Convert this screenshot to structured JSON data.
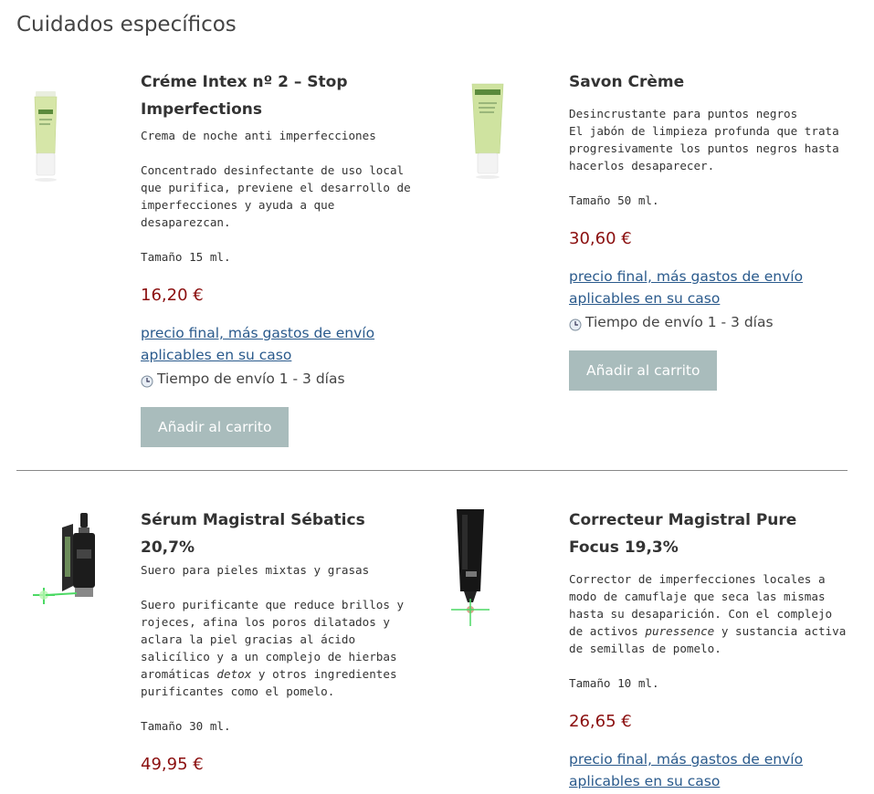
{
  "section_title": "Cuidados específicos",
  "products": [
    {
      "name": "Créme Intex nº 2 – Stop Imperfections",
      "subtitle": "Crema de noche anti imperfecciones",
      "description": "Concentrado desinfectante de uso local que purifica, previene el desarrollo de imperfecciones y ayuda a que desaparezcan.",
      "size": "Tamaño 15 ml.",
      "price": "16,20 €",
      "price_note": "precio final, más gastos de envío aplicables en su caso",
      "shipping": "Tiempo de envío 1 - 3 días",
      "button": "Añadir al carrito"
    },
    {
      "name": "Savon Crème",
      "subtitle": "Desincrustante para puntos negros",
      "description": "El jabón de limpieza profunda que trata progresivamente los puntos negros hasta hacerlos desaparecer.",
      "size": "Tamaño 50 ml.",
      "price": "30,60 €",
      "price_note": "precio final, más gastos de envío aplicables en su caso",
      "shipping": "Tiempo de envío 1 - 3 días",
      "button": "Añadir al carrito"
    },
    {
      "name": "Sérum Magistral Sébatics 20,7%",
      "subtitle": "Suero para pieles mixtas y grasas",
      "description_before": "Suero purificante que reduce brillos y rojeces, afina los poros dilatados y aclara la piel gracias al ácido salicílico y a un complejo de hierbas aromáticas ",
      "description_italic": "detox",
      "description_after": " y otros ingredientes purificantes como el pomelo.",
      "size": "Tamaño 30 ml.",
      "price": "49,95 €"
    },
    {
      "name": "Correcteur Magistral Pure Focus 19,3%",
      "description_before": "Corrector de imperfecciones locales a modo de camuflaje que seca las mismas hasta su desaparición. Con el complejo de activos ",
      "description_italic": "puressence",
      "description_after": " y sustancia activa de semillas de pomelo.",
      "size": "Tamaño 10 ml.",
      "price": "26,65 €",
      "price_note": "precio final, más gastos de envío aplicables en su caso"
    }
  ],
  "colors": {
    "price": "#8b0f0f",
    "link": "#2a5a8c",
    "button_bg": "#a9bcbc",
    "divider": "#888888"
  },
  "icons": {
    "shipping": "clock-icon"
  }
}
